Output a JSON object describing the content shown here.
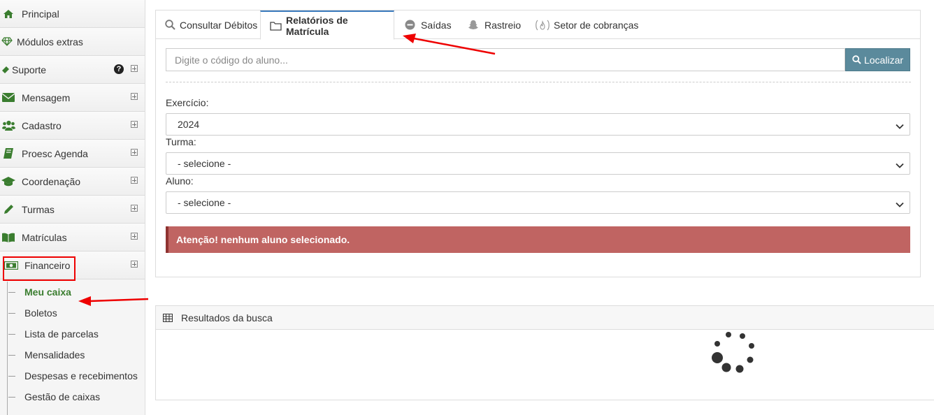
{
  "sidebar": {
    "items": [
      {
        "label": "Principal",
        "icon": "home-icon",
        "expand": false
      },
      {
        "label": "Módulos extras",
        "icon": "diamond-icon",
        "expand": false
      },
      {
        "label": "Suporte",
        "icon": "ticket-icon",
        "expand": true,
        "help": "?"
      },
      {
        "label": "Mensagem",
        "icon": "envelope-icon",
        "expand": true
      },
      {
        "label": "Cadastro",
        "icon": "users-icon",
        "expand": true
      },
      {
        "label": "Proesc Agenda",
        "icon": "book-icon",
        "expand": true
      },
      {
        "label": "Coordenação",
        "icon": "graduation-cap-icon",
        "expand": true
      },
      {
        "label": "Turmas",
        "icon": "pencil-icon",
        "expand": true
      },
      {
        "label": "Matrículas",
        "icon": "open-book-icon",
        "expand": true
      },
      {
        "label": "Financeiro",
        "icon": "money-icon",
        "expand": true
      }
    ],
    "financeiro_sub": [
      {
        "label": "Meu caixa",
        "active": true
      },
      {
        "label": "Boletos"
      },
      {
        "label": "Lista de parcelas"
      },
      {
        "label": "Mensalidades"
      },
      {
        "label": "Despesas e recebimentos"
      },
      {
        "label": "Gestão de caixas"
      }
    ]
  },
  "tabs": [
    {
      "label": "Consultar Débitos",
      "icon": "search-icon"
    },
    {
      "label": "Relatórios de Matrícula",
      "icon": "folder-icon",
      "active": true
    },
    {
      "label": "Saídas",
      "icon": "minus-circle-icon"
    },
    {
      "label": "Rastreio",
      "icon": "snapchat-icon"
    },
    {
      "label": "Setor de cobranças",
      "icon": "fire-icon"
    }
  ],
  "search": {
    "placeholder": "Digite o código do aluno...",
    "button_label": "Localizar"
  },
  "form": {
    "exercicio_label": "Exercício:",
    "exercicio_value": "2024",
    "turma_label": "Turma:",
    "turma_value": "- selecione -",
    "aluno_label": "Aluno:",
    "aluno_value": "- selecione -"
  },
  "alert": {
    "text": "Atenção! nenhum aluno selecionado."
  },
  "results": {
    "title": "Resultados da busca"
  },
  "colors": {
    "accent_green": "#3a7d2f",
    "button_teal": "#5b8a9c",
    "alert_red": "#c06462",
    "annotation_red": "#e00000"
  }
}
